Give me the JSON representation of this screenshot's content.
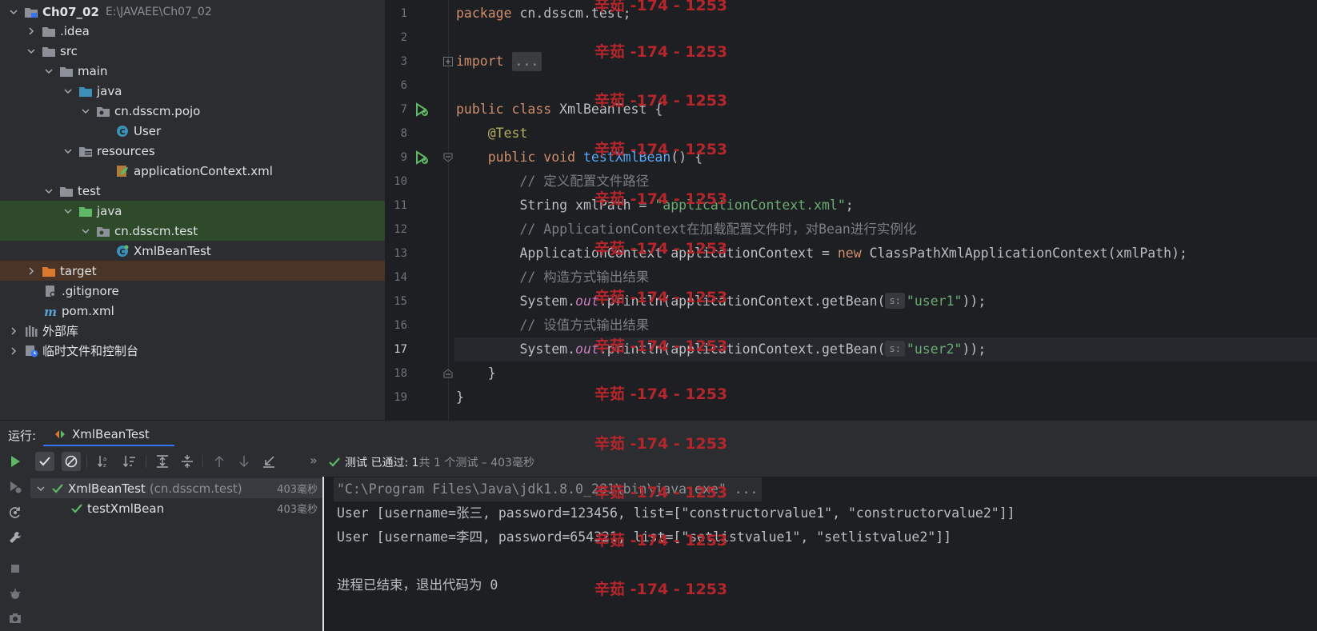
{
  "project": {
    "root_name": "Ch07_02",
    "root_path": "E:\\JAVAEE\\Ch07_02",
    "items": [
      {
        "label": "Ch07_02"
      },
      {
        "label": ".idea"
      },
      {
        "label": "src"
      },
      {
        "label": "main"
      },
      {
        "label": "java"
      },
      {
        "label": "cn.dsscm.pojo"
      },
      {
        "label": "User"
      },
      {
        "label": "resources"
      },
      {
        "label": "applicationContext.xml"
      },
      {
        "label": "test"
      },
      {
        "label": "java"
      },
      {
        "label": "cn.dsscm.test"
      },
      {
        "label": "XmlBeanTest"
      },
      {
        "label": "target"
      },
      {
        "label": ".gitignore"
      },
      {
        "label": "pom.xml"
      },
      {
        "label": "外部库"
      },
      {
        "label": "临时文件和控制台"
      }
    ]
  },
  "editor": {
    "lines": [
      {
        "n": "1",
        "t": "package cn.dsscm.test;"
      },
      {
        "n": "2",
        "t": ""
      },
      {
        "n": "3",
        "t": "import ..."
      },
      {
        "n": "6",
        "t": ""
      },
      {
        "n": "7",
        "t": "public class XmlBeanTest {"
      },
      {
        "n": "8",
        "t": "    @Test"
      },
      {
        "n": "9",
        "t": "    public void testXmlBean() {"
      },
      {
        "n": "10",
        "t": "        // 定义配置文件路径"
      },
      {
        "n": "11",
        "t": "        String xmlPath = \"applicationContext.xml\";"
      },
      {
        "n": "12",
        "t": "        // ApplicationContext在加载配置文件时，对Bean进行实例化"
      },
      {
        "n": "13",
        "t": "        ApplicationContext applicationContext = new ClassPathXmlApplicationContext(xmlPath);"
      },
      {
        "n": "14",
        "t": "        // 构造方式输出结果"
      },
      {
        "n": "15",
        "t": "        System.out.println(applicationContext.getBean(s: \"user1\"));"
      },
      {
        "n": "16",
        "t": "        // 设值方式输出结果"
      },
      {
        "n": "17",
        "t": "        System.out.println(applicationContext.getBean(s: \"user2\"));"
      },
      {
        "n": "18",
        "t": "    }"
      },
      {
        "n": "19",
        "t": "}"
      }
    ],
    "tokens": {
      "package_kw": "package",
      "package_name": " cn.dsscm.test;",
      "import_kw": "import",
      "import_fold": "...",
      "public": "public",
      "class": "class",
      "class_name": " XmlBeanTest {",
      "annotation": "@Test",
      "void": "void",
      "method": "testXmlBean",
      "method_tail": "() {",
      "c1": "// 定义配置文件路径",
      "l11_a": "String xmlPath = ",
      "l11_str": "\"applicationContext.xml\"",
      "l11_b": ";",
      "c2": "// ApplicationContext在加载配置文件时，对Bean进行实例化",
      "l13_a": "ApplicationContext applicationContext = ",
      "new": "new",
      "l13_b": " ClassPathXmlApplicationContext(xmlPath);",
      "c3": "// 构造方式输出结果",
      "sys": "System.",
      "out": "out",
      "println": ".println(applicationContext.getBean(",
      "hint": "s:",
      "u1": "\"user1\"",
      "close": "));",
      "c4": "// 设值方式输出结果",
      "u2": "\"user2\"",
      "brace_in": "    }",
      "brace_out": "}"
    }
  },
  "watermark": "辛茹 -174 - 1253",
  "run": {
    "label": "运行:",
    "tab": "XmlBeanTest",
    "status_pass": "测试 已通过: 1",
    "status_rest": "共 1 个测试 – 403毫秒",
    "tree": [
      {
        "name": "XmlBeanTest",
        "pkg": "(cn.dsscm.test)",
        "time": "403毫秒"
      },
      {
        "name": "testXmlBean",
        "time": "403毫秒"
      }
    ],
    "console": [
      "\"C:\\Program Files\\Java\\jdk1.8.0_281\\bin\\java.exe\" ...",
      "User [username=张三, password=123456, list=[\"constructorvalue1\", \"constructorvalue2\"]]",
      "User [username=李四, password=654321, list=[\"setlistvalue1\", \"setlistvalue2\"]]",
      "",
      "进程已结束，退出代码为 0"
    ]
  },
  "colors": {
    "accent": "#3574f0",
    "pass": "#5fb865",
    "watermark": "#b5262c"
  }
}
